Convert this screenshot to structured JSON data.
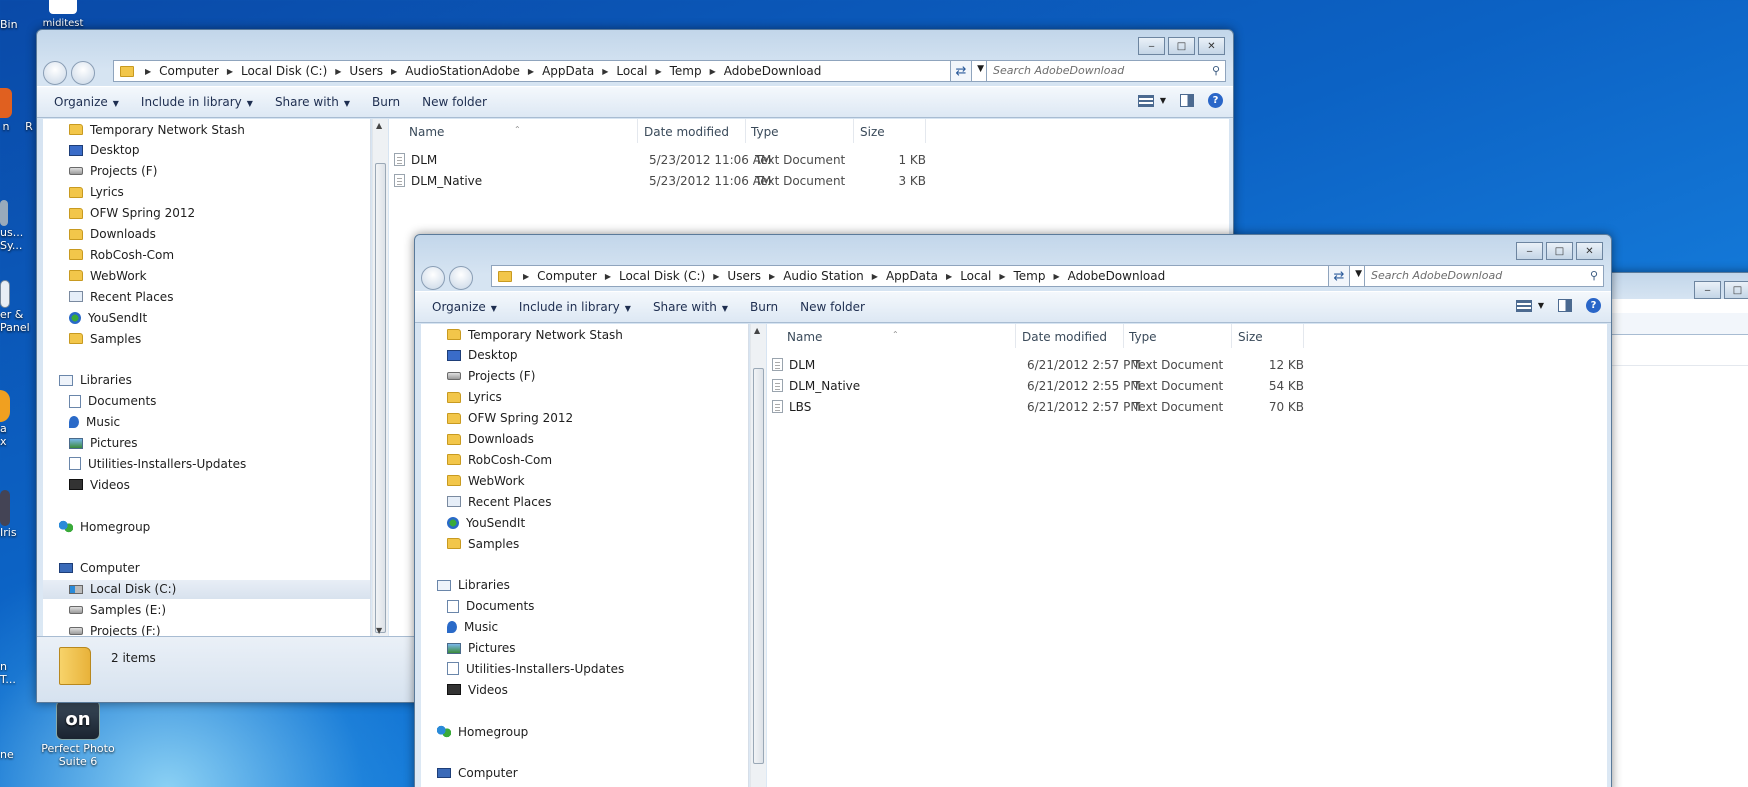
{
  "desktop": {
    "icons": [
      {
        "label": "Bin"
      },
      {
        "label": "miditest"
      },
      {
        "label": "n"
      },
      {
        "label": "R"
      },
      {
        "label": "us... Sy..."
      },
      {
        "label": "er & Panel"
      },
      {
        "label": "a x"
      },
      {
        "label": "Iris"
      },
      {
        "label": "n T..."
      },
      {
        "label": "ne"
      },
      {
        "label": "Perfect Photo Suite 6"
      }
    ]
  },
  "window_back": {
    "breadcrumb": [
      "Computer",
      "Local Disk (C:)",
      "Users",
      "AudioStationAdobe",
      "AppData",
      "Local",
      "Temp",
      "AdobeDownload"
    ],
    "search_placeholder": "Search AdobeDownload",
    "toolbar": {
      "organize": "Organize",
      "include": "Include in library",
      "share": "Share with",
      "burn": "Burn",
      "new_folder": "New folder"
    },
    "nav_items": [
      {
        "label": "Temporary Network Stash",
        "icon": "folder"
      },
      {
        "label": "Desktop",
        "icon": "desk"
      },
      {
        "label": "Projects (F)",
        "icon": "drive"
      },
      {
        "label": "Lyrics",
        "icon": "folder"
      },
      {
        "label": "OFW Spring 2012",
        "icon": "folder"
      },
      {
        "label": "Downloads",
        "icon": "folder"
      },
      {
        "label": "RobCosh-Com",
        "icon": "folder"
      },
      {
        "label": "WebWork",
        "icon": "folder"
      },
      {
        "label": "Recent Places",
        "icon": "recent"
      },
      {
        "label": "YouSendIt",
        "icon": "yousend"
      },
      {
        "label": "Samples",
        "icon": "folder"
      },
      {
        "label": "",
        "icon": ""
      },
      {
        "label": "Libraries",
        "icon": "lib",
        "top": true
      },
      {
        "label": "Documents",
        "icon": "doc"
      },
      {
        "label": "Music",
        "icon": "music"
      },
      {
        "label": "Pictures",
        "icon": "pic"
      },
      {
        "label": "Utilities-Installers-Updates",
        "icon": "doc"
      },
      {
        "label": "Videos",
        "icon": "vid"
      },
      {
        "label": "",
        "icon": ""
      },
      {
        "label": "Homegroup",
        "icon": "home",
        "top": true
      },
      {
        "label": "",
        "icon": ""
      },
      {
        "label": "Computer",
        "icon": "comp",
        "top": true
      },
      {
        "label": "Local Disk (C:)",
        "icon": "cdrive",
        "selected": true
      },
      {
        "label": "Samples (E:)",
        "icon": "drive"
      },
      {
        "label": "Projects (F:)",
        "icon": "drive"
      }
    ],
    "columns": {
      "name": "Name",
      "date": "Date modified",
      "type": "Type",
      "size": "Size"
    },
    "files": [
      {
        "name": "DLM",
        "date": "5/23/2012 11:06 AM",
        "type": "Text Document",
        "size": "1 KB"
      },
      {
        "name": "DLM_Native",
        "date": "5/23/2012 11:06 AM",
        "type": "Text Document",
        "size": "3 KB"
      }
    ],
    "status": "2 items"
  },
  "window_front": {
    "breadcrumb": [
      "Computer",
      "Local Disk (C:)",
      "Users",
      "Audio Station",
      "AppData",
      "Local",
      "Temp",
      "AdobeDownload"
    ],
    "search_placeholder": "Search AdobeDownload",
    "toolbar": {
      "organize": "Organize",
      "include": "Include in library",
      "share": "Share with",
      "burn": "Burn",
      "new_folder": "New folder"
    },
    "nav_items": [
      {
        "label": "Temporary Network Stash",
        "icon": "folder"
      },
      {
        "label": "Desktop",
        "icon": "desk"
      },
      {
        "label": "Projects (F)",
        "icon": "drive"
      },
      {
        "label": "Lyrics",
        "icon": "folder"
      },
      {
        "label": "OFW Spring 2012",
        "icon": "folder"
      },
      {
        "label": "Downloads",
        "icon": "folder"
      },
      {
        "label": "RobCosh-Com",
        "icon": "folder"
      },
      {
        "label": "WebWork",
        "icon": "folder"
      },
      {
        "label": "Recent Places",
        "icon": "recent"
      },
      {
        "label": "YouSendIt",
        "icon": "yousend"
      },
      {
        "label": "Samples",
        "icon": "folder"
      },
      {
        "label": "",
        "icon": ""
      },
      {
        "label": "Libraries",
        "icon": "lib",
        "top": true
      },
      {
        "label": "Documents",
        "icon": "doc"
      },
      {
        "label": "Music",
        "icon": "music"
      },
      {
        "label": "Pictures",
        "icon": "pic"
      },
      {
        "label": "Utilities-Installers-Updates",
        "icon": "doc"
      },
      {
        "label": "Videos",
        "icon": "vid"
      },
      {
        "label": "",
        "icon": ""
      },
      {
        "label": "Homegroup",
        "icon": "home",
        "top": true
      },
      {
        "label": "",
        "icon": ""
      },
      {
        "label": "Computer",
        "icon": "comp",
        "top": true
      }
    ],
    "columns": {
      "name": "Name",
      "date": "Date modified",
      "type": "Type",
      "size": "Size"
    },
    "files": [
      {
        "name": "DLM",
        "date": "6/21/2012 2:57 PM",
        "type": "Text Document",
        "size": "12 KB"
      },
      {
        "name": "DLM_Native",
        "date": "6/21/2012 2:55 PM",
        "type": "Text Document",
        "size": "54 KB"
      },
      {
        "name": "LBS",
        "date": "6/21/2012 2:57 PM",
        "type": "Text Document",
        "size": "70 KB"
      }
    ]
  }
}
